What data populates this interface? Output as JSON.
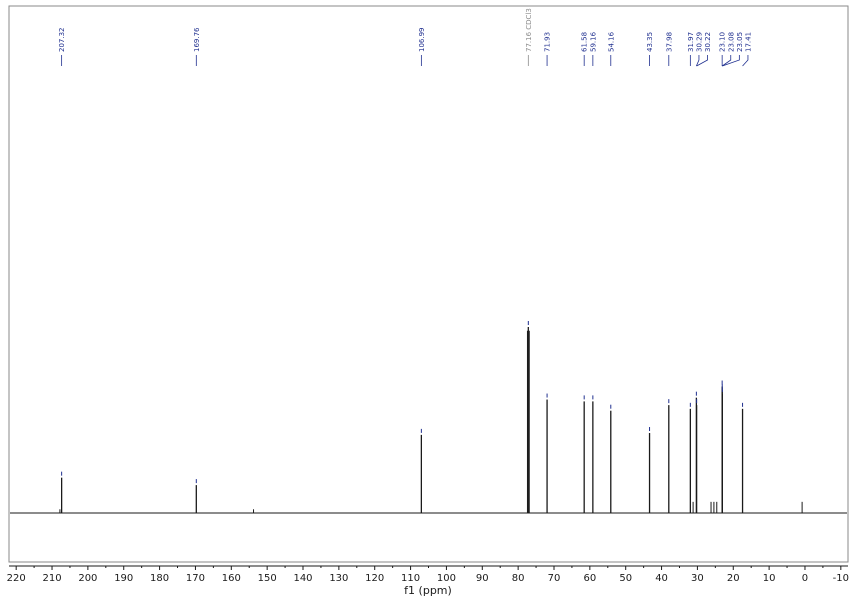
{
  "chart_data": {
    "type": "line",
    "xlabel": "f1 (ppm)",
    "xlim": [
      222,
      -12
    ],
    "x_reversed": true,
    "ylim": [
      -0.26,
      1.0
    ],
    "grid": false,
    "xticks": [
      220,
      210,
      200,
      190,
      180,
      170,
      160,
      150,
      140,
      130,
      120,
      110,
      100,
      90,
      80,
      70,
      60,
      50,
      40,
      30,
      20,
      10,
      0,
      -10
    ],
    "xtick_labels": [
      "220",
      "210",
      "200",
      "190",
      "180",
      "170",
      "160",
      "150",
      "140",
      "130",
      "120",
      "110",
      "100",
      "90",
      "80",
      "70",
      "60",
      "50",
      "40",
      "30",
      "20",
      "10",
      "0",
      "-10"
    ],
    "peaks": [
      {
        "x": 207.32,
        "y": 0.19
      },
      {
        "x": 169.76,
        "y": 0.15
      },
      {
        "x": 106.99,
        "y": 0.42
      },
      {
        "x": 77.16,
        "y": 1.0
      },
      {
        "x": 71.93,
        "y": 0.61
      },
      {
        "x": 61.58,
        "y": 0.6
      },
      {
        "x": 59.16,
        "y": 0.6
      },
      {
        "x": 54.16,
        "y": 0.55
      },
      {
        "x": 43.35,
        "y": 0.43
      },
      {
        "x": 37.98,
        "y": 0.58
      },
      {
        "x": 31.97,
        "y": 0.56
      },
      {
        "x": 30.29,
        "y": 0.62
      },
      {
        "x": 30.22,
        "y": 0.58
      },
      {
        "x": 23.1,
        "y": 0.68
      },
      {
        "x": 23.08,
        "y": 0.66
      },
      {
        "x": 23.05,
        "y": 0.64
      },
      {
        "x": 17.41,
        "y": 0.56
      }
    ],
    "minor_peaks": [
      {
        "x": 207.8,
        "y": 0.02
      },
      {
        "x": 153.8,
        "y": 0.02
      },
      {
        "x": 76.9,
        "y": 0.98
      },
      {
        "x": 77.4,
        "y": 0.98
      },
      {
        "x": 31.2,
        "y": 0.06
      },
      {
        "x": 26.2,
        "y": 0.06
      },
      {
        "x": 25.4,
        "y": 0.06
      },
      {
        "x": 24.6,
        "y": 0.06
      },
      {
        "x": 0.8,
        "y": 0.06
      }
    ],
    "peak_labels": [
      {
        "text": "207.32",
        "x": 207.32
      },
      {
        "text": "169.76",
        "x": 169.76
      },
      {
        "text": "106.99",
        "x": 106.99
      },
      {
        "text": "77.16 CDCl3",
        "x": 77.16,
        "solvent": true
      },
      {
        "text": "71.93",
        "x": 71.93
      },
      {
        "text": "61.58",
        "x": 61.58
      },
      {
        "text": "59.16",
        "x": 59.16
      },
      {
        "text": "54.16",
        "x": 54.16
      },
      {
        "text": "43.35",
        "x": 43.35
      },
      {
        "text": "37.98",
        "x": 37.98
      },
      {
        "text": "31.97",
        "x": 31.97
      },
      {
        "text": "30.29",
        "x": 30.29
      },
      {
        "text": "30.22",
        "x": 30.22
      },
      {
        "text": "23.10",
        "x": 23.1
      },
      {
        "text": "23.08",
        "x": 23.08
      },
      {
        "text": "23.05",
        "x": 23.05
      },
      {
        "text": "17.41",
        "x": 17.41
      }
    ],
    "colors": {
      "spectrum": "#1a1a1a",
      "peak_label": "#1f2f8f",
      "solvent_label": "#8c8c8c",
      "frame": "#8a8a8a"
    }
  }
}
